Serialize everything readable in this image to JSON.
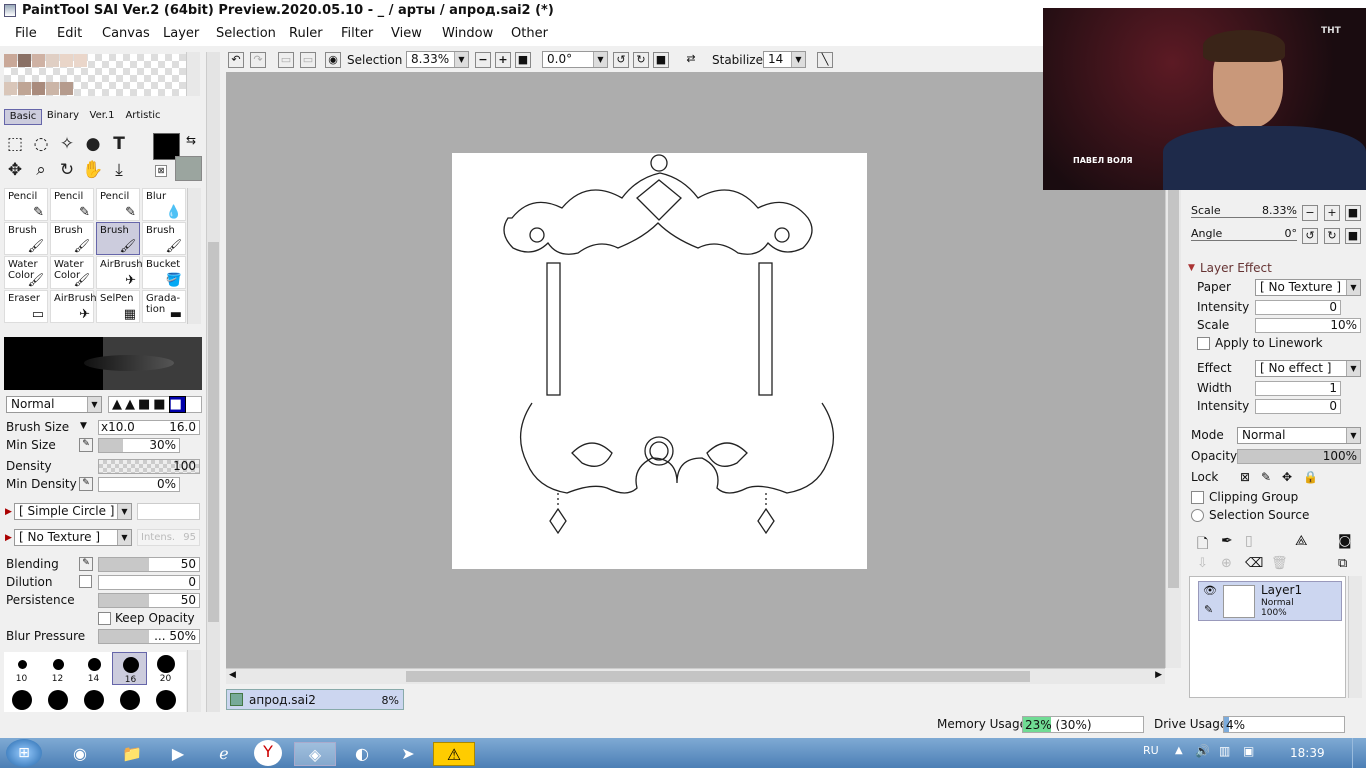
{
  "window": {
    "title": "PaintTool SAI Ver.2 (64bit) Preview.2020.05.10 - _ / арты / апрод.sai2 (*)"
  },
  "menu": [
    "File",
    "Edit",
    "Canvas",
    "Layer",
    "Selection",
    "Ruler",
    "Filter",
    "View",
    "Window",
    "Other"
  ],
  "swatches": [
    "#c9a898",
    "#8a7065",
    "#cfb2a4",
    "#e0cfc4",
    "#e9d5c8",
    "#ead6ca",
    "#d9c6b9",
    "#bfa595",
    "#a98b7d",
    "#cbb5a7",
    "#b59b8d"
  ],
  "tool_tabs": [
    "Basic",
    "Binary",
    "Ver.1",
    "Artistic"
  ],
  "tools": [
    {
      "name": "Pencil",
      "icon": "✎"
    },
    {
      "name": "Pencil",
      "icon": "✎"
    },
    {
      "name": "Pencil",
      "icon": "✎"
    },
    {
      "name": "Blur",
      "icon": "💧"
    },
    {
      "name": "Brush",
      "icon": "🖌"
    },
    {
      "name": "Brush",
      "icon": "🖌"
    },
    {
      "name": "Brush",
      "icon": "🖌"
    },
    {
      "name": "Brush",
      "icon": "🖌"
    },
    {
      "name": "Water Color",
      "icon": "🖌"
    },
    {
      "name": "Water Color",
      "icon": "🖌"
    },
    {
      "name": "AirBrush",
      "icon": "✈"
    },
    {
      "name": "Bucket",
      "icon": "🪣"
    },
    {
      "name": "Eraser",
      "icon": "▭"
    },
    {
      "name": "AirBrush",
      "icon": "✈"
    },
    {
      "name": "SelPen",
      "icon": "▦"
    },
    {
      "name": "Grada-tion",
      "icon": "▬"
    }
  ],
  "brush": {
    "mode": "Normal",
    "size_label": "Brush Size",
    "size_mult": "x10.0",
    "size": "16.0",
    "min_size_label": "Min Size",
    "min_size": "30%",
    "density_label": "Density",
    "density": "100",
    "min_density_label": "Min Density",
    "min_density": "0%",
    "shape": "[ Simple Circle ]",
    "texture": "[ No Texture ]",
    "intens": "Intens.",
    "intens_val": "95",
    "blending_label": "Blending",
    "blending": "50",
    "dilution_label": "Dilution",
    "dilution": "0",
    "persistence_label": "Persistence",
    "persistence": "50",
    "keep_opacity": "Keep Opacity",
    "blur_label": "Blur Pressure",
    "blur": "... 50%"
  },
  "brush_sizes": [
    "10",
    "12",
    "14",
    "16",
    "20"
  ],
  "toolbar": {
    "selection_label": "Selection",
    "zoom": "8.33%",
    "angle": "0.0°",
    "stabilizer_label": "Stabilizer",
    "stabilizer": "14"
  },
  "right": {
    "scale_label": "Scale",
    "scale": "8.33%",
    "angle_label": "Angle",
    "angle": "0°",
    "layer_effect": "Layer Effect",
    "paper_label": "Paper",
    "paper": "[ No Texture ]",
    "intensity_label": "Intensity",
    "intensity": "0",
    "scale2_label": "Scale",
    "scale2": "10%",
    "apply_linework": "Apply to Linework",
    "effect_label": "Effect",
    "effect": "[ No effect ]",
    "width_label": "Width",
    "width": "1",
    "intensity2_label": "Intensity",
    "intensity2": "0",
    "mode_label": "Mode",
    "mode": "Normal",
    "opacity_label": "Opacity",
    "opacity": "100%",
    "lock_label": "Lock",
    "clipping": "Clipping Group",
    "selsource": "Selection Source"
  },
  "layer": {
    "name": "Layer1",
    "mode": "Normal",
    "opacity": "100%"
  },
  "doc_tab": {
    "name": "апрод.sai2",
    "zoom": "8%"
  },
  "status": {
    "memory_label": "Memory Usage",
    "memory": "23% (30%)",
    "memory_pct": 23,
    "drive_label": "Drive Usage",
    "drive": "4%",
    "drive_pct": 4
  },
  "taskbar": {
    "lang": "RU",
    "time": "18:39"
  },
  "video": {
    "caption": "ПАВЕЛ ВОЛЯ",
    "channel": "ТНТ"
  }
}
